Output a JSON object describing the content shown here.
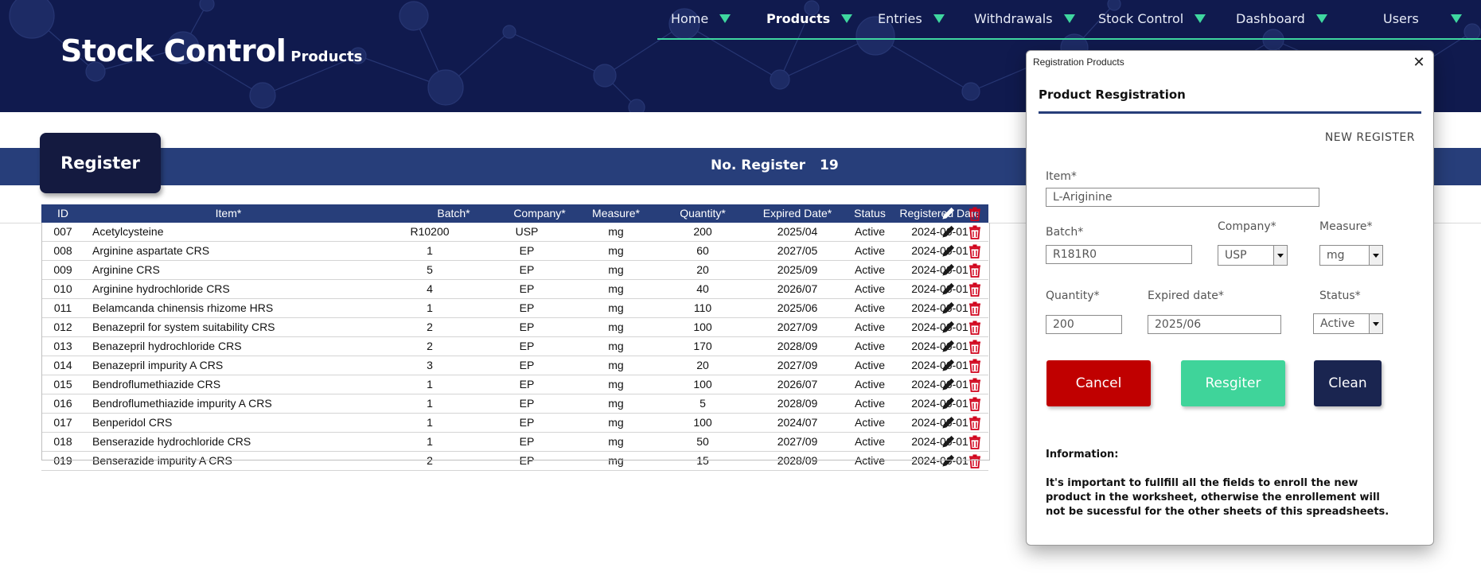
{
  "header": {
    "app_title": "Stock Control",
    "app_subtitle": "Products",
    "nav": [
      {
        "label": "Home"
      },
      {
        "label": "Products"
      },
      {
        "label": "Entries"
      },
      {
        "label": "Withdrawals"
      },
      {
        "label": "Stock Control"
      },
      {
        "label": "Dashboard"
      },
      {
        "label": "Users"
      }
    ],
    "active_nav": "Products",
    "accent_color": "#3fd7a0",
    "banner_color": "#101a4e"
  },
  "register_bar": {
    "tab_label": "Register",
    "count_label": "No. Register",
    "count_value": "19"
  },
  "table": {
    "columns": [
      "ID",
      "Item*",
      "Batch*",
      "Company*",
      "Measure*",
      "Quantity*",
      "Expired Date*",
      "Status",
      "Registered Date"
    ],
    "header_icons": [
      "pencil-icon",
      "trash-icon"
    ],
    "rows": [
      [
        "007",
        "Acetylcysteine",
        "R10200",
        "USP",
        "mg",
        "200",
        "2025/04",
        "Active",
        "2024-06-01"
      ],
      [
        "008",
        "Arginine aspartate CRS",
        "1",
        "EP",
        "mg",
        "60",
        "2027/05",
        "Active",
        "2024-06-01"
      ],
      [
        "009",
        "Arginine CRS",
        "5",
        "EP",
        "mg",
        "20",
        "2025/09",
        "Active",
        "2024-06-01"
      ],
      [
        "010",
        "Arginine hydrochloride CRS",
        "4",
        "EP",
        "mg",
        "40",
        "2026/07",
        "Active",
        "2024-06-01"
      ],
      [
        "011",
        "Belamcanda chinensis rhizome HRS",
        "1",
        "EP",
        "mg",
        "110",
        "2025/06",
        "Active",
        "2024-06-01"
      ],
      [
        "012",
        "Benazepril for system suitability CRS",
        "2",
        "EP",
        "mg",
        "100",
        "2027/09",
        "Active",
        "2024-06-01"
      ],
      [
        "013",
        "Benazepril hydrochloride CRS",
        "2",
        "EP",
        "mg",
        "170",
        "2028/09",
        "Active",
        "2024-06-01"
      ],
      [
        "014",
        "Benazepril impurity A CRS",
        "3",
        "EP",
        "mg",
        "20",
        "2027/09",
        "Active",
        "2024-06-01"
      ],
      [
        "015",
        "Bendroflumethiazide CRS",
        "1",
        "EP",
        "mg",
        "100",
        "2026/07",
        "Active",
        "2024-06-01"
      ],
      [
        "016",
        "Bendroflumethiazide impurity A CRS",
        "1",
        "EP",
        "mg",
        "5",
        "2028/09",
        "Active",
        "2024-06-01"
      ],
      [
        "017",
        "Benperidol CRS",
        "1",
        "EP",
        "mg",
        "100",
        "2024/07",
        "Active",
        "2024-06-01"
      ],
      [
        "018",
        "Benserazide hydrochloride CRS",
        "1",
        "EP",
        "mg",
        "50",
        "2027/09",
        "Active",
        "2024-06-01"
      ],
      [
        "019",
        "Benserazide impurity A CRS",
        "2",
        "EP",
        "mg",
        "15",
        "2028/09",
        "Active",
        "2024-06-01"
      ]
    ],
    "header_color": "#273e7a",
    "edit_icon_color": "#1a1a1a",
    "delete_icon_color": "#d0021b"
  },
  "dialog": {
    "window_title": "Registration Products",
    "heading": "Product Resgistration",
    "mode_label": "NEW REGISTER",
    "fields": {
      "item": {
        "label": "Item*",
        "value": "L-Ariginine"
      },
      "batch": {
        "label": "Batch*",
        "value": "R181R0"
      },
      "company": {
        "label": "Company*",
        "value": "USP"
      },
      "measure": {
        "label": "Measure*",
        "value": "mg"
      },
      "quantity": {
        "label": "Quantity*",
        "value": "200"
      },
      "expired": {
        "label": "Expired date*",
        "value": "2025/06"
      },
      "status": {
        "label": "Status*",
        "value": "Active"
      }
    },
    "buttons": {
      "cancel": {
        "label": "Cancel",
        "color": "#c00000"
      },
      "register": {
        "label": "Resgiter",
        "color": "#3fd49a"
      },
      "clean": {
        "label": "Clean",
        "color": "#1a2550"
      }
    },
    "info_heading": "Information:",
    "info_text": "It's important to fullfill all the fields to enroll the new product in the worksheet, otherwise the enrollement will not be sucessful for the other sheets of this spreadsheets."
  }
}
